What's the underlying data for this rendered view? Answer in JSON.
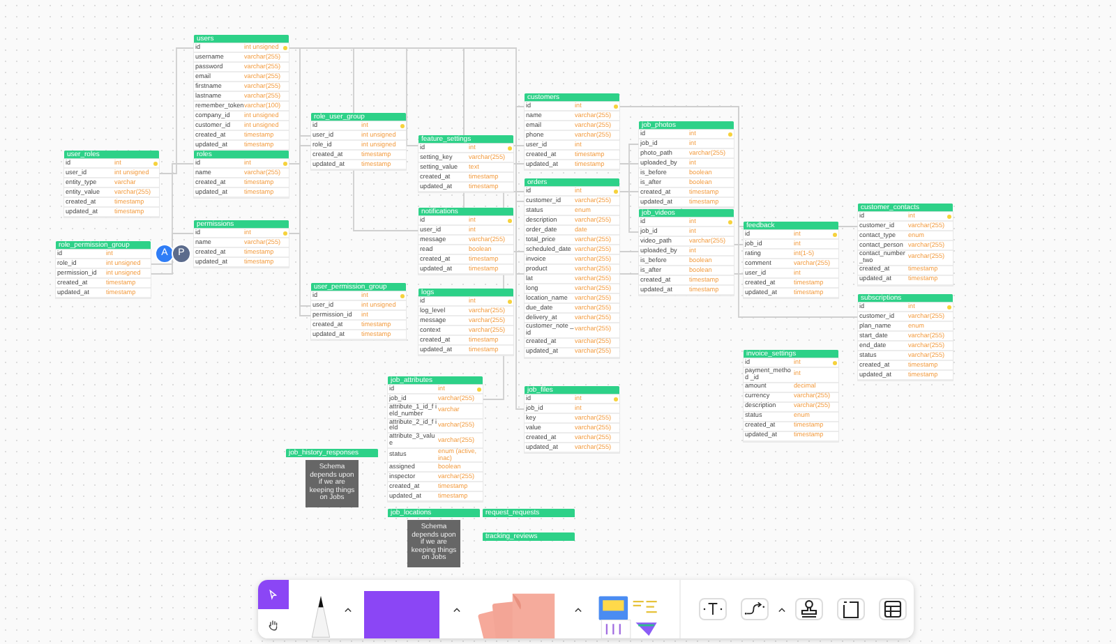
{
  "canvas": {
    "tables": [
      {
        "kind": "table",
        "name": "users",
        "columns": [
          {
            "name": "id",
            "type": "int unsigned",
            "key": true
          },
          {
            "name": "username",
            "type": "varchar(255)",
            "key": false
          },
          {
            "name": "password",
            "type": "varchar(255)",
            "key": false
          },
          {
            "name": "email",
            "type": "varchar(255)",
            "key": false
          },
          {
            "name": "firstname",
            "type": "varchar(255)",
            "key": false
          },
          {
            "name": "lastname",
            "type": "varchar(255)",
            "key": false
          },
          {
            "name": "remember_token",
            "type": "varchar(100)",
            "key": false
          },
          {
            "name": "company_id",
            "type": "int unsigned",
            "key": false
          },
          {
            "name": "customer_id",
            "type": "int unsigned",
            "key": false
          },
          {
            "name": "created_at",
            "type": "timestamp",
            "key": false
          },
          {
            "name": "updated_at",
            "type": "timestamp",
            "key": false
          }
        ]
      },
      {
        "kind": "table",
        "name": "user_roles",
        "columns": [
          {
            "name": "id",
            "type": "int",
            "key": true
          },
          {
            "name": "user_id",
            "type": "int unsigned",
            "key": false
          },
          {
            "name": "entity_type",
            "type": "varchar",
            "key": false
          },
          {
            "name": "entity_value",
            "type": "varchar(255)",
            "key": false
          },
          {
            "name": "created_at",
            "type": "timestamp",
            "key": false
          },
          {
            "name": "updated_at",
            "type": "timestamp",
            "key": false
          }
        ]
      },
      {
        "kind": "table",
        "name": "roles",
        "columns": [
          {
            "name": "id",
            "type": "int",
            "key": true
          },
          {
            "name": "name",
            "type": "varchar(255)",
            "key": false
          },
          {
            "name": "created_at",
            "type": "timestamp",
            "key": false
          },
          {
            "name": "updated_at",
            "type": "timestamp",
            "key": false
          }
        ]
      },
      {
        "kind": "table",
        "name": "permissions",
        "columns": [
          {
            "name": "id",
            "type": "int",
            "key": true
          },
          {
            "name": "name",
            "type": "varchar(255)",
            "key": false
          },
          {
            "name": "created_at",
            "type": "timestamp",
            "key": false
          },
          {
            "name": "updated_at",
            "type": "timestamp",
            "key": false
          }
        ]
      },
      {
        "kind": "table",
        "name": "role_permission_group",
        "columns": [
          {
            "name": "id",
            "type": "int",
            "key": false
          },
          {
            "name": "role_id",
            "type": "int unsigned",
            "key": false
          },
          {
            "name": "permission_id",
            "type": "int unsigned",
            "key": false
          },
          {
            "name": "created_at",
            "type": "timestamp",
            "key": false
          },
          {
            "name": "updated_at",
            "type": "timestamp",
            "key": false
          }
        ]
      },
      {
        "kind": "table",
        "name": "role_user_group",
        "columns": [
          {
            "name": "id",
            "type": "int",
            "key": true
          },
          {
            "name": "user_id",
            "type": "int unsigned",
            "key": false
          },
          {
            "name": "role_id",
            "type": "int unsigned",
            "key": false
          },
          {
            "name": "created_at",
            "type": "timestamp",
            "key": false
          },
          {
            "name": "updated_at",
            "type": "timestamp",
            "key": false
          }
        ]
      },
      {
        "kind": "table",
        "name": "user_permission_group",
        "columns": [
          {
            "name": "id",
            "type": "int",
            "key": true
          },
          {
            "name": "user_id",
            "type": "int unsigned",
            "key": false
          },
          {
            "name": "permission_id",
            "type": "int",
            "key": false
          },
          {
            "name": "created_at",
            "type": "timestamp",
            "key": false
          },
          {
            "name": "updated_at",
            "type": "timestamp",
            "key": false
          }
        ]
      },
      {
        "kind": "table",
        "name": "feature_settings",
        "columns": [
          {
            "name": "id",
            "type": "int",
            "key": true
          },
          {
            "name": "setting_key",
            "type": "varchar(255)",
            "key": false
          },
          {
            "name": "setting_value",
            "type": "text",
            "key": false
          },
          {
            "name": "created_at",
            "type": "timestamp",
            "key": false
          },
          {
            "name": "updated_at",
            "type": "timestamp",
            "key": false
          }
        ]
      },
      {
        "kind": "table",
        "name": "notifications",
        "columns": [
          {
            "name": "id",
            "type": "int",
            "key": true
          },
          {
            "name": "user_id",
            "type": "int",
            "key": false
          },
          {
            "name": "message",
            "type": "varchar(255)",
            "key": false
          },
          {
            "name": "read",
            "type": "boolean",
            "key": false
          },
          {
            "name": "created_at",
            "type": "timestamp",
            "key": false
          },
          {
            "name": "updated_at",
            "type": "timestamp",
            "key": false
          }
        ]
      },
      {
        "kind": "table",
        "name": "logs",
        "columns": [
          {
            "name": "id",
            "type": "int",
            "key": true
          },
          {
            "name": "log_level",
            "type": "varchar(255)",
            "key": false
          },
          {
            "name": "message",
            "type": "varchar(255)",
            "key": false
          },
          {
            "name": "context",
            "type": "varchar(255)",
            "key": false
          },
          {
            "name": "created_at",
            "type": "timestamp",
            "key": false
          },
          {
            "name": "updated_at",
            "type": "timestamp",
            "key": false
          }
        ]
      },
      {
        "kind": "table",
        "name": "customers",
        "columns": [
          {
            "name": "id",
            "type": "int",
            "key": true
          },
          {
            "name": "name",
            "type": "varchar(255)",
            "key": false
          },
          {
            "name": "email",
            "type": "varchar(255)",
            "key": false
          },
          {
            "name": "phone",
            "type": "varchar(255)",
            "key": false
          },
          {
            "name": "user_id",
            "type": "int",
            "key": false
          },
          {
            "name": "created_at",
            "type": "timestamp",
            "key": false
          },
          {
            "name": "updated_at",
            "type": "timestamp",
            "key": false
          }
        ]
      },
      {
        "kind": "table",
        "name": "orders",
        "columns": [
          {
            "name": "id",
            "type": "int",
            "key": true
          },
          {
            "name": "customer_id",
            "type": "varchar(255)",
            "key": false
          },
          {
            "name": "status",
            "type": "enum",
            "key": false
          },
          {
            "name": "description",
            "type": "varchar(255)",
            "key": false
          },
          {
            "name": "order_date",
            "type": "date",
            "key": false
          },
          {
            "name": "total_price",
            "type": "varchar(255)",
            "key": false
          },
          {
            "name": "scheduled_date",
            "type": "varchar(255)",
            "key": false
          },
          {
            "name": "invoice",
            "type": "varchar(255)",
            "key": false
          },
          {
            "name": "product",
            "type": "varchar(255)",
            "key": false
          },
          {
            "name": "lat",
            "type": "varchar(255)",
            "key": false
          },
          {
            "name": "long",
            "type": "varchar(255)",
            "key": false
          },
          {
            "name": "location_name",
            "type": "varchar(255)",
            "key": false
          },
          {
            "name": "due_date",
            "type": "varchar(255)",
            "key": false
          },
          {
            "name": "delivery_at",
            "type": "varchar(255)",
            "key": false
          },
          {
            "name": "customer_note _id",
            "type": "varchar(255)",
            "key": false
          },
          {
            "name": "created_at",
            "type": "varchar(255)",
            "key": false
          },
          {
            "name": "updated_at",
            "type": "varchar(255)",
            "key": false
          }
        ]
      },
      {
        "kind": "table",
        "name": "job_photos",
        "columns": [
          {
            "name": "id",
            "type": "int",
            "key": true
          },
          {
            "name": "job_id",
            "type": "int",
            "key": false
          },
          {
            "name": "photo_path",
            "type": "varchar(255)",
            "key": false
          },
          {
            "name": "uploaded_by",
            "type": "int",
            "key": false
          },
          {
            "name": "is_before",
            "type": "boolean",
            "key": false
          },
          {
            "name": "is_after",
            "type": "boolean",
            "key": false
          },
          {
            "name": "created_at",
            "type": "timestamp",
            "key": false
          },
          {
            "name": "updated_at",
            "type": "timestamp",
            "key": false
          }
        ]
      },
      {
        "kind": "table",
        "name": "job_videos",
        "columns": [
          {
            "name": "id",
            "type": "int",
            "key": true
          },
          {
            "name": "job_id",
            "type": "int",
            "key": false
          },
          {
            "name": "video_path",
            "type": "varchar(255)",
            "key": false
          },
          {
            "name": "uploaded_by",
            "type": "int",
            "key": false
          },
          {
            "name": "is_before",
            "type": "boolean",
            "key": false
          },
          {
            "name": "is_after",
            "type": "boolean",
            "key": false
          },
          {
            "name": "created_at",
            "type": "timestamp",
            "key": false
          },
          {
            "name": "updated_at",
            "type": "timestamp",
            "key": false
          }
        ]
      },
      {
        "kind": "table",
        "name": "feedback",
        "columns": [
          {
            "name": "id",
            "type": "int",
            "key": true
          },
          {
            "name": "job_id",
            "type": "int",
            "key": false
          },
          {
            "name": "rating",
            "type": "int(1-5)",
            "key": false
          },
          {
            "name": "comment",
            "type": "varchar(255)",
            "key": false
          },
          {
            "name": "user_id",
            "type": "int",
            "key": false
          },
          {
            "name": "created_at",
            "type": "timestamp",
            "key": false
          },
          {
            "name": "updated_at",
            "type": "timestamp",
            "key": false
          }
        ]
      },
      {
        "kind": "table",
        "name": "customer_contacts",
        "columns": [
          {
            "name": "id",
            "type": "int",
            "key": true
          },
          {
            "name": "customer_id",
            "type": "varchar(255)",
            "key": false
          },
          {
            "name": "contact_type",
            "type": "enum",
            "key": false
          },
          {
            "name": "contact_person",
            "type": "varchar(255)",
            "key": false
          },
          {
            "name": "contact_number _two",
            "type": "varchar(255)",
            "key": false
          },
          {
            "name": "created_at",
            "type": "timestamp",
            "key": false
          },
          {
            "name": "updated_at",
            "type": "timestamp",
            "key": false
          }
        ]
      },
      {
        "kind": "table",
        "name": "subscriptions",
        "columns": [
          {
            "name": "id",
            "type": "int",
            "key": true
          },
          {
            "name": "customer_id",
            "type": "varchar(255)",
            "key": false
          },
          {
            "name": "plan_name",
            "type": "enum",
            "key": false
          },
          {
            "name": "start_date",
            "type": "varchar(255)",
            "key": false
          },
          {
            "name": "end_date",
            "type": "varchar(255)",
            "key": false
          },
          {
            "name": "status",
            "type": "varchar(255)",
            "key": false
          },
          {
            "name": "created_at",
            "type": "timestamp",
            "key": false
          },
          {
            "name": "updated_at",
            "type": "timestamp",
            "key": false
          }
        ]
      },
      {
        "kind": "table",
        "name": "invoice_settings",
        "columns": [
          {
            "name": "id",
            "type": "int",
            "key": true
          },
          {
            "name": "payment_method _id",
            "type": "int",
            "key": false
          },
          {
            "name": "amount",
            "type": "decimal",
            "key": false
          },
          {
            "name": "currency",
            "type": "varchar(255)",
            "key": false
          },
          {
            "name": "description",
            "type": "varchar(255)",
            "key": false
          },
          {
            "name": "status",
            "type": "enum",
            "key": false
          },
          {
            "name": "created_at",
            "type": "timestamp",
            "key": false
          },
          {
            "name": "updated_at",
            "type": "timestamp",
            "key": false
          }
        ]
      },
      {
        "kind": "table",
        "name": "job_attributes",
        "columns": [
          {
            "name": "id",
            "type": "int",
            "key": true
          },
          {
            "name": "job_id",
            "type": "varchar(255)",
            "key": false
          },
          {
            "name": "attribute_1_id_f ield_number",
            "type": "varchar",
            "key": false
          },
          {
            "name": "attribute_2_id_f ield",
            "type": "varchar(255)",
            "key": false
          },
          {
            "name": "attribute_3_value",
            "type": "varchar(255)",
            "key": false
          },
          {
            "name": "status",
            "type": "enum (active, inac)",
            "key": false
          },
          {
            "name": "assigned",
            "type": "boolean",
            "key": false
          },
          {
            "name": "inspector",
            "type": "varchar(255)",
            "key": false
          },
          {
            "name": "created_at",
            "type": "timestamp",
            "key": false
          },
          {
            "name": "updated_at",
            "type": "timestamp",
            "key": false
          }
        ]
      },
      {
        "kind": "table",
        "name": "job_files",
        "columns": [
          {
            "name": "id",
            "type": "int",
            "key": true
          },
          {
            "name": "job_id",
            "type": "int",
            "key": false
          },
          {
            "name": "key",
            "type": "varchar(255)",
            "key": false
          },
          {
            "name": "value",
            "type": "varchar(255)",
            "key": false
          },
          {
            "name": "created_at",
            "type": "varchar(255)",
            "key": false
          },
          {
            "name": "updated_at",
            "type": "varchar(255)",
            "key": false
          }
        ]
      },
      {
        "kind": "note",
        "name": "job_history_responses",
        "note": "Schema depends upon if we are keeping things on Jobs"
      },
      {
        "kind": "note",
        "name": "job_locations",
        "note": "Schema depends upon if we are keeping things on Jobs"
      },
      {
        "kind": "empty",
        "name": "request_requests"
      },
      {
        "kind": "empty",
        "name": "tracking_reviews"
      }
    ]
  },
  "collaborators": [
    {
      "initial": "A",
      "color": "#2f7df6"
    },
    {
      "initial": "P",
      "color": "#5b6b8c"
    }
  ],
  "toolbar": {
    "modes": [
      {
        "kind": "select",
        "selected": true
      },
      {
        "kind": "hand",
        "selected": false
      }
    ]
  }
}
